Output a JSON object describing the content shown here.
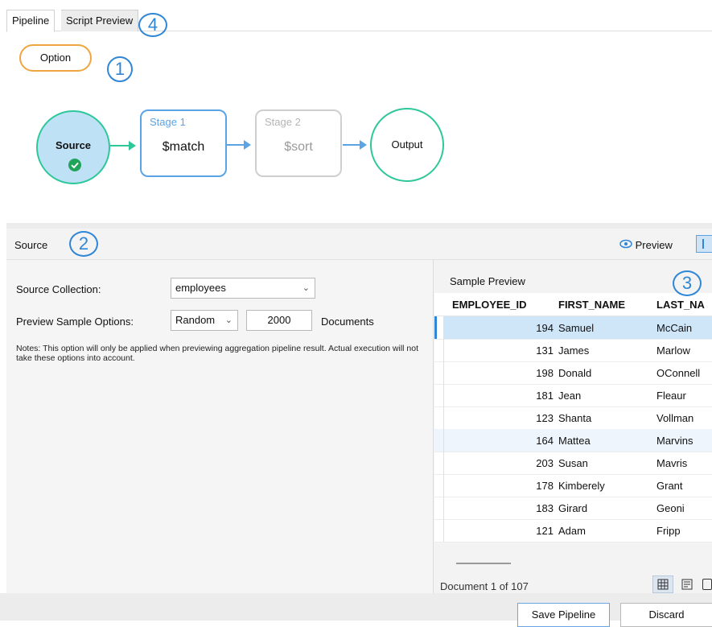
{
  "tabs": {
    "pipeline": "Pipeline",
    "script_preview": "Script Preview"
  },
  "callouts": {
    "one": "1",
    "two": "2",
    "three": "3",
    "four": "4"
  },
  "diagram": {
    "option_label": "Option",
    "source_label": "Source",
    "stage1": {
      "label": "Stage 1",
      "op": "$match"
    },
    "stage2": {
      "label": "Stage 2",
      "op": "$sort"
    },
    "output_label": "Output"
  },
  "source_panel": {
    "title": "Source",
    "preview_label": "Preview",
    "collection_label": "Source Collection:",
    "collection_value": "employees",
    "sample_options_label": "Preview Sample Options:",
    "sample_mode": "Random",
    "sample_count": "2000",
    "documents_label": "Documents",
    "notes": "Notes: This option will only be applied when previewing aggregation pipeline result. Actual execution will not take these options into account."
  },
  "sample_preview": {
    "title": "Sample Preview",
    "columns": [
      "EMPLOYEE_ID",
      "FIRST_NAME",
      "LAST_NA"
    ],
    "rows": [
      {
        "id": "194",
        "first": "Samuel",
        "last": "McCain"
      },
      {
        "id": "131",
        "first": "James",
        "last": "Marlow"
      },
      {
        "id": "198",
        "first": "Donald",
        "last": "OConnell"
      },
      {
        "id": "181",
        "first": "Jean",
        "last": "Fleaur"
      },
      {
        "id": "123",
        "first": "Shanta",
        "last": "Vollman"
      },
      {
        "id": "164",
        "first": "Mattea",
        "last": "Marvins"
      },
      {
        "id": "203",
        "first": "Susan",
        "last": "Mavris"
      },
      {
        "id": "178",
        "first": "Kimberely",
        "last": "Grant"
      },
      {
        "id": "183",
        "first": "Girard",
        "last": "Geoni"
      },
      {
        "id": "121",
        "first": "Adam",
        "last": "Fripp"
      }
    ],
    "status": "Document 1 of 107"
  },
  "buttons": {
    "save": "Save Pipeline",
    "discard": "Discard"
  },
  "colors": {
    "accent": "#2f86d6",
    "option_border": "#f0a640",
    "source_fill": "#bfe1f6",
    "node_border": "#2dc79a",
    "selected_row": "#cfe5f8"
  }
}
